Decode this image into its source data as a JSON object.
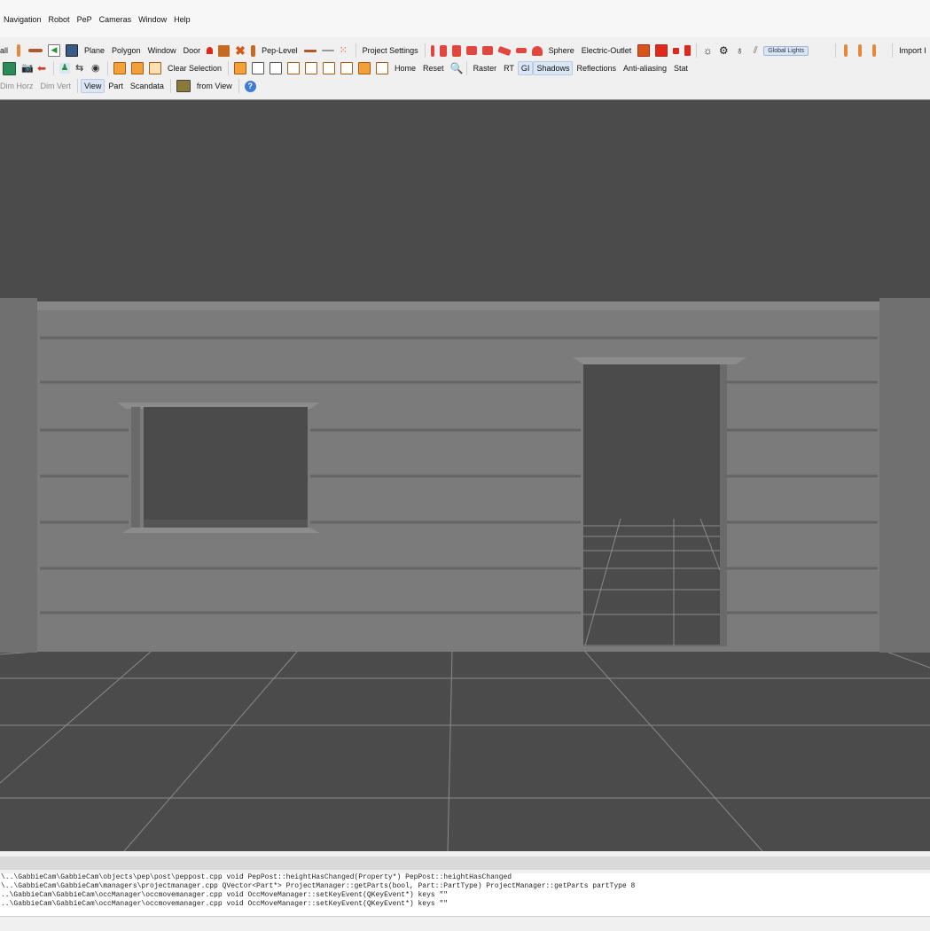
{
  "menu": [
    "Navigation",
    "Robot",
    "PeP",
    "Cameras",
    "Window",
    "Help"
  ],
  "toolbar1": {
    "wall": "all",
    "plane": "Plane",
    "polygon": "Polygon",
    "window": "Window",
    "door": "Door",
    "pep_level": "Pep-Level",
    "project_settings": "Project Settings",
    "sphere": "Sphere",
    "electric_outlet": "Electric-Outlet",
    "global_lights": "Global Lights",
    "import": "Import I"
  },
  "toolbar2": {
    "clear_selection": "Clear Selection",
    "home": "Home",
    "reset": "Reset",
    "raster": "Raster",
    "rt": "RT",
    "gi": "GI",
    "shadows": "Shadows",
    "reflections": "Reflections",
    "anti_aliasing": "Anti-aliasing",
    "stat": "Stat"
  },
  "toolbar3": {
    "dim_horz": "Dim Horz",
    "dim_vert": "Dim Vert",
    "view": "View",
    "part": "Part",
    "scandata": "Scandata",
    "from_view": "from View"
  },
  "console_lines": [
    "\\..\\GabbieCam\\GabbieCam\\objects\\pep\\post\\peppost.cpp void PepPost::heightHasChanged(Property*) PepPost::heightHasChanged",
    "\\..\\GabbieCam\\GabbieCam\\managers\\projectmanager.cpp QVector<Part*> ProjectManager::getParts(bool, Part::PartType) ProjectManager::getParts partType 8",
    "..\\GabbieCam\\GabbieCam\\occManager\\occmovemanager.cpp void OccMoveManager::setKeyEvent(QKeyEvent*) keys \"\"",
    "..\\GabbieCam\\GabbieCam\\occManager\\occmovemanager.cpp void OccMoveManager::setKeyEvent(QKeyEvent*) keys \"\""
  ],
  "colors": {
    "viewport_bg": "#4b4b4b",
    "wall": "#7a7a7a",
    "accent_orange": "#e8893a",
    "accent_red": "#e0281d",
    "toggle_on": "#dbe6f4"
  },
  "icons": [
    "bottle-icon",
    "plank-icon",
    "arrow-left-green-icon",
    "monitor-icon",
    "bell-icon",
    "cube-orange-icon",
    "cross-icon",
    "slab-icon",
    "dots-grid-icon",
    "red-shape-icon",
    "sun-icon",
    "gear-icon",
    "bulb-icon",
    "rays-icon",
    "camera-icon",
    "robot-icon",
    "eye-icon",
    "search-icon",
    "help-icon"
  ]
}
